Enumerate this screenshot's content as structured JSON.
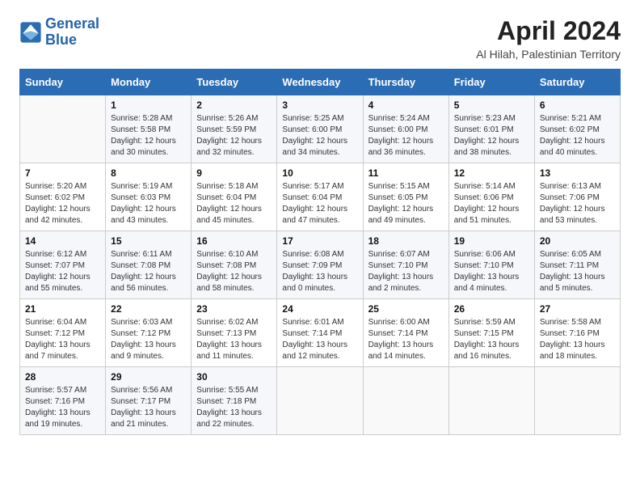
{
  "logo": {
    "line1": "General",
    "line2": "Blue"
  },
  "title": "April 2024",
  "location": "Al Hilah, Palestinian Territory",
  "header": {
    "columns": [
      "Sunday",
      "Monday",
      "Tuesday",
      "Wednesday",
      "Thursday",
      "Friday",
      "Saturday"
    ]
  },
  "weeks": [
    [
      {
        "day": "",
        "content": ""
      },
      {
        "day": "1",
        "content": "Sunrise: 5:28 AM\nSunset: 5:58 PM\nDaylight: 12 hours\nand 30 minutes."
      },
      {
        "day": "2",
        "content": "Sunrise: 5:26 AM\nSunset: 5:59 PM\nDaylight: 12 hours\nand 32 minutes."
      },
      {
        "day": "3",
        "content": "Sunrise: 5:25 AM\nSunset: 6:00 PM\nDaylight: 12 hours\nand 34 minutes."
      },
      {
        "day": "4",
        "content": "Sunrise: 5:24 AM\nSunset: 6:00 PM\nDaylight: 12 hours\nand 36 minutes."
      },
      {
        "day": "5",
        "content": "Sunrise: 5:23 AM\nSunset: 6:01 PM\nDaylight: 12 hours\nand 38 minutes."
      },
      {
        "day": "6",
        "content": "Sunrise: 5:21 AM\nSunset: 6:02 PM\nDaylight: 12 hours\nand 40 minutes."
      }
    ],
    [
      {
        "day": "7",
        "content": "Sunrise: 5:20 AM\nSunset: 6:02 PM\nDaylight: 12 hours\nand 42 minutes."
      },
      {
        "day": "8",
        "content": "Sunrise: 5:19 AM\nSunset: 6:03 PM\nDaylight: 12 hours\nand 43 minutes."
      },
      {
        "day": "9",
        "content": "Sunrise: 5:18 AM\nSunset: 6:04 PM\nDaylight: 12 hours\nand 45 minutes."
      },
      {
        "day": "10",
        "content": "Sunrise: 5:17 AM\nSunset: 6:04 PM\nDaylight: 12 hours\nand 47 minutes."
      },
      {
        "day": "11",
        "content": "Sunrise: 5:15 AM\nSunset: 6:05 PM\nDaylight: 12 hours\nand 49 minutes."
      },
      {
        "day": "12",
        "content": "Sunrise: 5:14 AM\nSunset: 6:06 PM\nDaylight: 12 hours\nand 51 minutes."
      },
      {
        "day": "13",
        "content": "Sunrise: 6:13 AM\nSunset: 7:06 PM\nDaylight: 12 hours\nand 53 minutes."
      }
    ],
    [
      {
        "day": "14",
        "content": "Sunrise: 6:12 AM\nSunset: 7:07 PM\nDaylight: 12 hours\nand 55 minutes."
      },
      {
        "day": "15",
        "content": "Sunrise: 6:11 AM\nSunset: 7:08 PM\nDaylight: 12 hours\nand 56 minutes."
      },
      {
        "day": "16",
        "content": "Sunrise: 6:10 AM\nSunset: 7:08 PM\nDaylight: 12 hours\nand 58 minutes."
      },
      {
        "day": "17",
        "content": "Sunrise: 6:08 AM\nSunset: 7:09 PM\nDaylight: 13 hours\nand 0 minutes."
      },
      {
        "day": "18",
        "content": "Sunrise: 6:07 AM\nSunset: 7:10 PM\nDaylight: 13 hours\nand 2 minutes."
      },
      {
        "day": "19",
        "content": "Sunrise: 6:06 AM\nSunset: 7:10 PM\nDaylight: 13 hours\nand 4 minutes."
      },
      {
        "day": "20",
        "content": "Sunrise: 6:05 AM\nSunset: 7:11 PM\nDaylight: 13 hours\nand 5 minutes."
      }
    ],
    [
      {
        "day": "21",
        "content": "Sunrise: 6:04 AM\nSunset: 7:12 PM\nDaylight: 13 hours\nand 7 minutes."
      },
      {
        "day": "22",
        "content": "Sunrise: 6:03 AM\nSunset: 7:12 PM\nDaylight: 13 hours\nand 9 minutes."
      },
      {
        "day": "23",
        "content": "Sunrise: 6:02 AM\nSunset: 7:13 PM\nDaylight: 13 hours\nand 11 minutes."
      },
      {
        "day": "24",
        "content": "Sunrise: 6:01 AM\nSunset: 7:14 PM\nDaylight: 13 hours\nand 12 minutes."
      },
      {
        "day": "25",
        "content": "Sunrise: 6:00 AM\nSunset: 7:14 PM\nDaylight: 13 hours\nand 14 minutes."
      },
      {
        "day": "26",
        "content": "Sunrise: 5:59 AM\nSunset: 7:15 PM\nDaylight: 13 hours\nand 16 minutes."
      },
      {
        "day": "27",
        "content": "Sunrise: 5:58 AM\nSunset: 7:16 PM\nDaylight: 13 hours\nand 18 minutes."
      }
    ],
    [
      {
        "day": "28",
        "content": "Sunrise: 5:57 AM\nSunset: 7:16 PM\nDaylight: 13 hours\nand 19 minutes."
      },
      {
        "day": "29",
        "content": "Sunrise: 5:56 AM\nSunset: 7:17 PM\nDaylight: 13 hours\nand 21 minutes."
      },
      {
        "day": "30",
        "content": "Sunrise: 5:55 AM\nSunset: 7:18 PM\nDaylight: 13 hours\nand 22 minutes."
      },
      {
        "day": "",
        "content": ""
      },
      {
        "day": "",
        "content": ""
      },
      {
        "day": "",
        "content": ""
      },
      {
        "day": "",
        "content": ""
      }
    ]
  ]
}
